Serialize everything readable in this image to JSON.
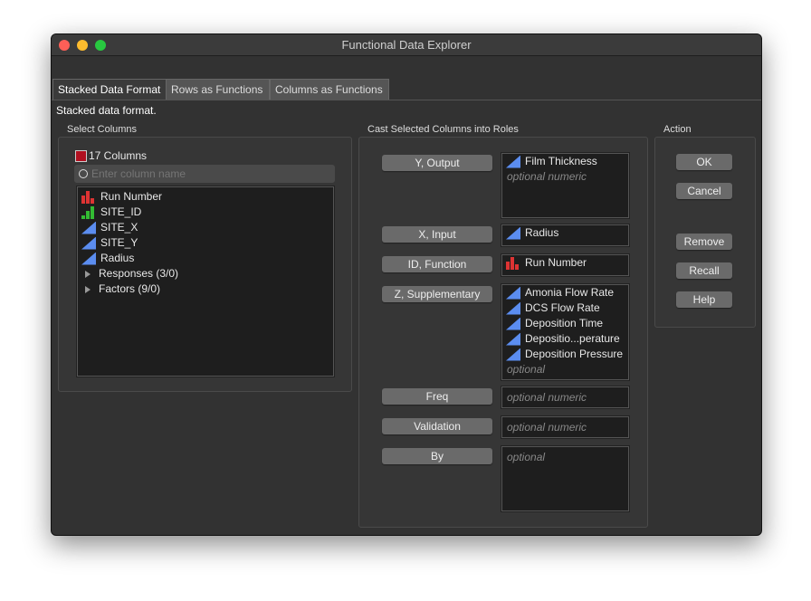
{
  "window": {
    "title": "Functional Data Explorer"
  },
  "tabs": [
    "Stacked Data Format",
    "Rows as Functions",
    "Columns as Functions"
  ],
  "description": "Stacked data format.",
  "select_columns": {
    "label": "Select Columns",
    "count_label": "17 Columns",
    "search_placeholder": "Enter column name",
    "items": [
      {
        "label": "Run Number",
        "type": "nominal"
      },
      {
        "label": "SITE_ID",
        "type": "ordinal"
      },
      {
        "label": "SITE_X",
        "type": "continuous"
      },
      {
        "label": "SITE_Y",
        "type": "continuous"
      },
      {
        "label": "Radius",
        "type": "continuous"
      }
    ],
    "groups": [
      "Responses (3/0)",
      "Factors (9/0)"
    ]
  },
  "roles": {
    "label": "Cast Selected Columns into Roles",
    "y": {
      "button": "Y, Output",
      "items": [
        "Film Thickness"
      ],
      "hint": "optional numeric"
    },
    "x": {
      "button": "X, Input",
      "items": [
        "Radius"
      ]
    },
    "id": {
      "button": "ID, Function",
      "items": [
        "Run Number"
      ]
    },
    "z": {
      "button": "Z, Supplementary",
      "items": [
        "Amonia Flow Rate",
        "DCS Flow Rate",
        "Deposition Time",
        "Depositio...perature",
        "Deposition Pressure"
      ],
      "hint": "optional"
    },
    "freq": {
      "button": "Freq",
      "hint": "optional numeric"
    },
    "validation": {
      "button": "Validation",
      "hint": "optional numeric"
    },
    "by": {
      "button": "By",
      "hint": "optional"
    }
  },
  "action": {
    "label": "Action",
    "ok": "OK",
    "cancel": "Cancel",
    "remove": "Remove",
    "recall": "Recall",
    "help": "Help"
  }
}
